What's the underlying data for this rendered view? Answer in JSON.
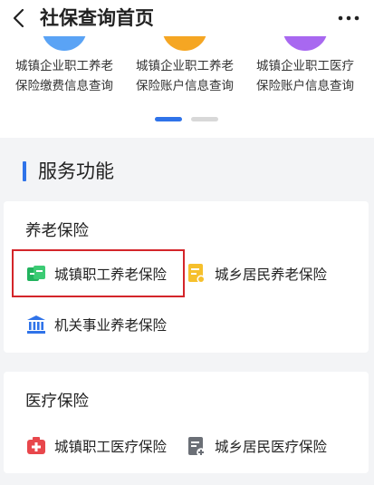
{
  "header": {
    "title": "社保查询首页",
    "back_icon": "chevron-left-icon",
    "more_icon": "more-dots-icon"
  },
  "top_tiles": [
    {
      "line1": "城镇企业职工养老",
      "line2": "保险缴费信息查询",
      "color": "#5aa3f5"
    },
    {
      "line1": "城镇企业职工养老",
      "line2": "保险账户信息查询",
      "color": "#f5a623"
    },
    {
      "line1": "城镇企业职工医疗",
      "line2": "保险账户信息查询",
      "color": "#a868f0"
    }
  ],
  "section": {
    "title": "服务功能",
    "accent": "#2f73e9"
  },
  "pension": {
    "title": "养老保险",
    "items": [
      {
        "label": "城镇职工养老保险",
        "icon": "green-cards-icon",
        "color": "#22b35e"
      },
      {
        "label": "城乡居民养老保险",
        "icon": "yellow-doc-icon",
        "color": "#f6c02c"
      },
      {
        "label": "机关事业养老保险",
        "icon": "bank-building-icon",
        "color": "#2f73e9"
      }
    ]
  },
  "medical": {
    "title": "医疗保险",
    "items": [
      {
        "label": "城镇职工医疗保险",
        "icon": "red-medkit-icon",
        "color": "#e8474c"
      },
      {
        "label": "城乡居民医疗保险",
        "icon": "gray-clipboard-plus-icon",
        "color": "#6b6f76"
      }
    ]
  }
}
